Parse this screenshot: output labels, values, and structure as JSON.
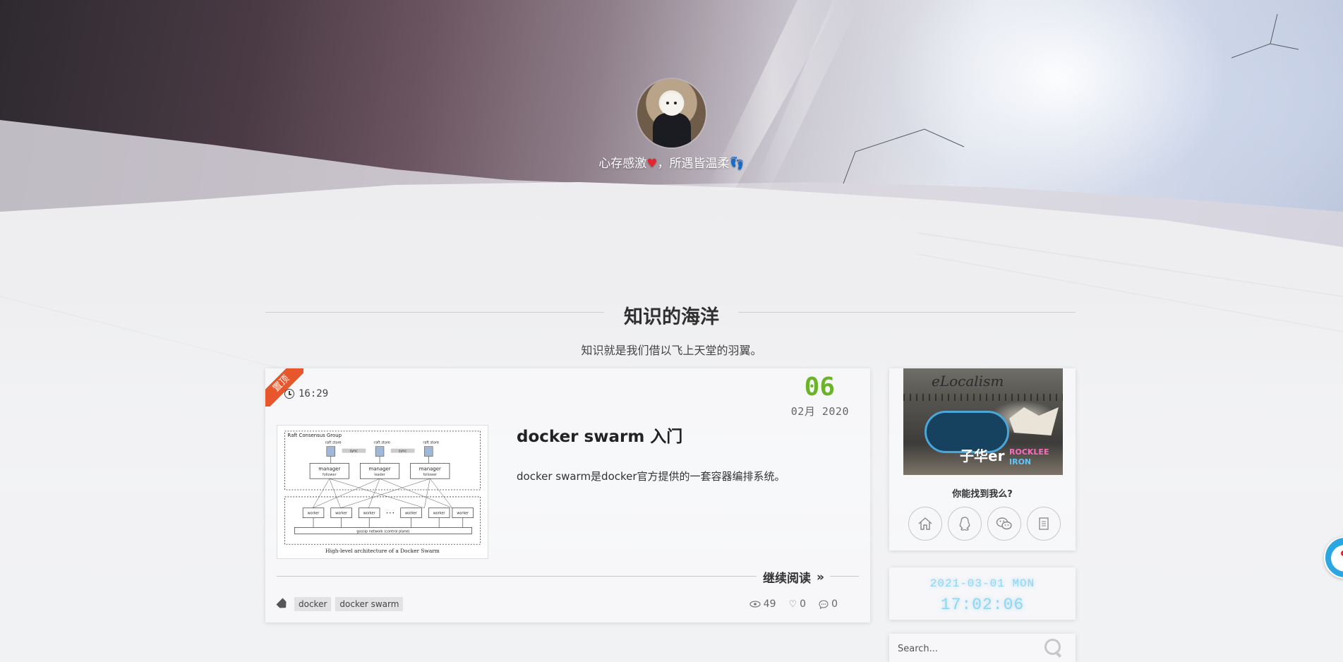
{
  "hero": {
    "motto_part1": "心存感激",
    "heart": "♥",
    "motto_part2": "，所遇皆温柔",
    "footprints": "👣"
  },
  "section": {
    "title": "知识的海洋",
    "subtitle": "知识就是我们借以飞上天堂的羽翼。"
  },
  "post": {
    "pinned_label": "置顶",
    "time": "16:29",
    "day": "06",
    "month_year": "02月 2020",
    "title": "docker swarm 入门",
    "excerpt": "docker swarm是docker官方提供的一套容器编排系统。",
    "read_more": "继续阅读",
    "read_more_icon": "»",
    "tags": [
      "docker",
      "docker swarm"
    ],
    "views": "49",
    "likes": "0",
    "comments": "0",
    "thumbnail": {
      "group_label": "Raft Consensus Group",
      "raft_store": "raft store",
      "sync": "sync",
      "manager": "manager",
      "follower": "follower",
      "leader": "leader",
      "worker": "worker",
      "ellipsis": "• • •",
      "gossip": "gossip network (control plane)",
      "caption": "High-level architecture of a Docker Swarm"
    }
  },
  "sidebar": {
    "find_me": "你能找到我么?",
    "graffiti_text": {
      "title": "eLocalism",
      "name": "子华er",
      "tag_a": "ROCKLEE",
      "tag_b": "IRON"
    },
    "social_icons": [
      "home-icon",
      "qq-icon",
      "wechat-icon",
      "article-icon"
    ],
    "clock_date": "2021-03-01 MON",
    "clock_time": "17:02:06",
    "search_placeholder": "Search..."
  },
  "colors": {
    "accent_green": "#6bb42a",
    "pin_orange": "#e8572c",
    "clock_cyan": "#8fd6f2",
    "heart_red": "#e2262d"
  }
}
